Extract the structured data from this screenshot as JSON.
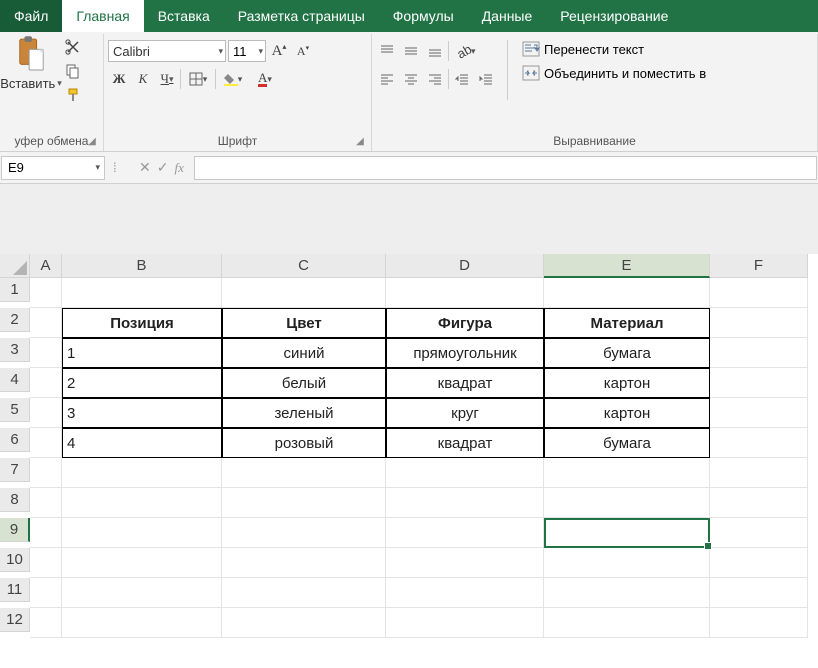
{
  "tabs": {
    "file": "Файл",
    "home": "Главная",
    "insert": "Вставка",
    "page_layout": "Разметка страницы",
    "formulas": "Формулы",
    "data": "Данные",
    "review": "Рецензирование"
  },
  "ribbon": {
    "clipboard": {
      "paste": "Вставить",
      "label": "уфер обмена"
    },
    "font": {
      "name": "Calibri",
      "size": "11",
      "bold": "Ж",
      "italic": "К",
      "underline": "Ч",
      "label": "Шрифт"
    },
    "alignment": {
      "wrap": "Перенести текст",
      "merge": "Объединить и поместить в ",
      "label": "Выравнивание"
    }
  },
  "namebox": "E9",
  "fx": "fx",
  "columns": [
    "A",
    "B",
    "C",
    "D",
    "E",
    "F"
  ],
  "rows": [
    "1",
    "2",
    "3",
    "4",
    "5",
    "6",
    "7",
    "8",
    "9",
    "10",
    "11",
    "12"
  ],
  "selected_col_idx": 4,
  "selected_row_idx": 8,
  "table": {
    "headers": [
      "Позиция",
      "Цвет",
      "Фигура",
      "Материал"
    ],
    "data": [
      [
        "1",
        "синий",
        "прямоугольник",
        "бумага"
      ],
      [
        "2",
        "белый",
        "квадрат",
        "картон"
      ],
      [
        "3",
        "зеленый",
        "круг",
        "картон"
      ],
      [
        "4",
        "розовый",
        "квадрат",
        "бумага"
      ]
    ]
  }
}
